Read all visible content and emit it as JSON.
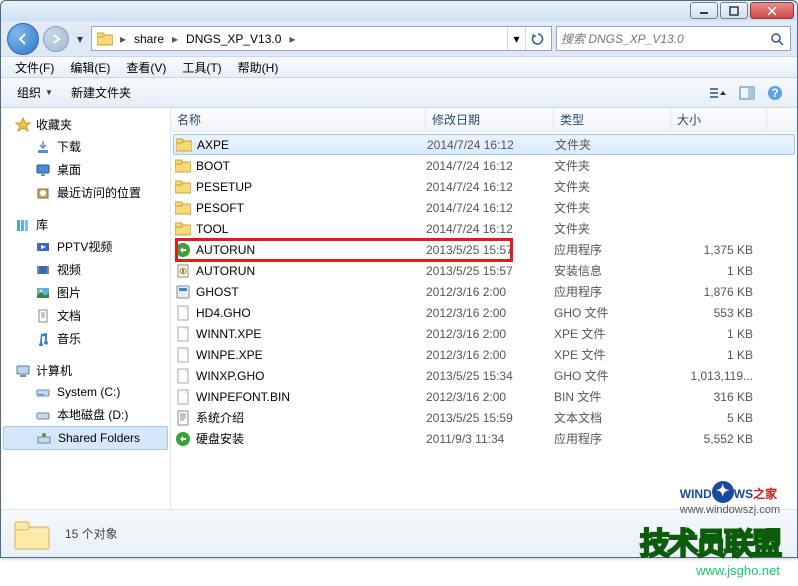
{
  "breadcrumb": {
    "seg1": "share",
    "seg2": "DNGS_XP_V13.0"
  },
  "search": {
    "placeholder": "搜索 DNGS_XP_V13.0"
  },
  "menubar": {
    "file": "文件(F)",
    "edit": "编辑(E)",
    "view": "查看(V)",
    "tools": "工具(T)",
    "help": "帮助(H)"
  },
  "toolbar": {
    "org": "组织",
    "newfolder": "新建文件夹"
  },
  "sidebar": {
    "fav": {
      "head": "收藏夹",
      "items": [
        "下载",
        "桌面",
        "最近访问的位置"
      ]
    },
    "lib": {
      "head": "库",
      "items": [
        "PPTV视频",
        "视频",
        "图片",
        "文档",
        "音乐"
      ]
    },
    "pc": {
      "head": "计算机",
      "items": [
        "System (C:)",
        "本地磁盘 (D:)",
        "Shared Folders"
      ]
    }
  },
  "columns": {
    "name": "名称",
    "date": "修改日期",
    "type": "类型",
    "size": "大小"
  },
  "files": [
    {
      "name": "AXPE",
      "date": "2014/7/24 16:12",
      "type": "文件夹",
      "size": "",
      "icon": "folder"
    },
    {
      "name": "BOOT",
      "date": "2014/7/24 16:12",
      "type": "文件夹",
      "size": "",
      "icon": "folder"
    },
    {
      "name": "PESETUP",
      "date": "2014/7/24 16:12",
      "type": "文件夹",
      "size": "",
      "icon": "folder"
    },
    {
      "name": "PESOFT",
      "date": "2014/7/24 16:12",
      "type": "文件夹",
      "size": "",
      "icon": "folder"
    },
    {
      "name": "TOOL",
      "date": "2014/7/24 16:12",
      "type": "文件夹",
      "size": "",
      "icon": "folder"
    },
    {
      "name": "AUTORUN",
      "date": "2013/5/25 15:57",
      "type": "应用程序",
      "size": "1,375 KB",
      "icon": "exe-green"
    },
    {
      "name": "AUTORUN",
      "date": "2013/5/25 15:57",
      "type": "安装信息",
      "size": "1 KB",
      "icon": "inf"
    },
    {
      "name": "GHOST",
      "date": "2012/3/16 2:00",
      "type": "应用程序",
      "size": "1,876 KB",
      "icon": "exe"
    },
    {
      "name": "HD4.GHO",
      "date": "2012/3/16 2:00",
      "type": "GHO 文件",
      "size": "553 KB",
      "icon": "file"
    },
    {
      "name": "WINNT.XPE",
      "date": "2012/3/16 2:00",
      "type": "XPE 文件",
      "size": "1 KB",
      "icon": "file"
    },
    {
      "name": "WINPE.XPE",
      "date": "2012/3/16 2:00",
      "type": "XPE 文件",
      "size": "1 KB",
      "icon": "file"
    },
    {
      "name": "WINXP.GHO",
      "date": "2013/5/25 15:34",
      "type": "GHO 文件",
      "size": "1,013,119...",
      "icon": "file"
    },
    {
      "name": "WINPEFONT.BIN",
      "date": "2012/3/16 2:00",
      "type": "BIN 文件",
      "size": "316 KB",
      "icon": "file"
    },
    {
      "name": "系统介绍",
      "date": "2013/5/25 15:59",
      "type": "文本文档",
      "size": "5 KB",
      "icon": "txt"
    },
    {
      "name": "硬盘安装",
      "date": "2011/9/3 11:34",
      "type": "应用程序",
      "size": "5,552 KB",
      "icon": "exe-green"
    }
  ],
  "status": {
    "count": "15 个对象"
  },
  "watermark": {
    "brand_pre": "WIND",
    "brand_o": "O",
    "brand_post": "WS",
    "brand_suffix": "之家",
    "url1": "www.windowszj.com",
    "big": "技术员联盟",
    "url2": "www.jsgho.net"
  }
}
